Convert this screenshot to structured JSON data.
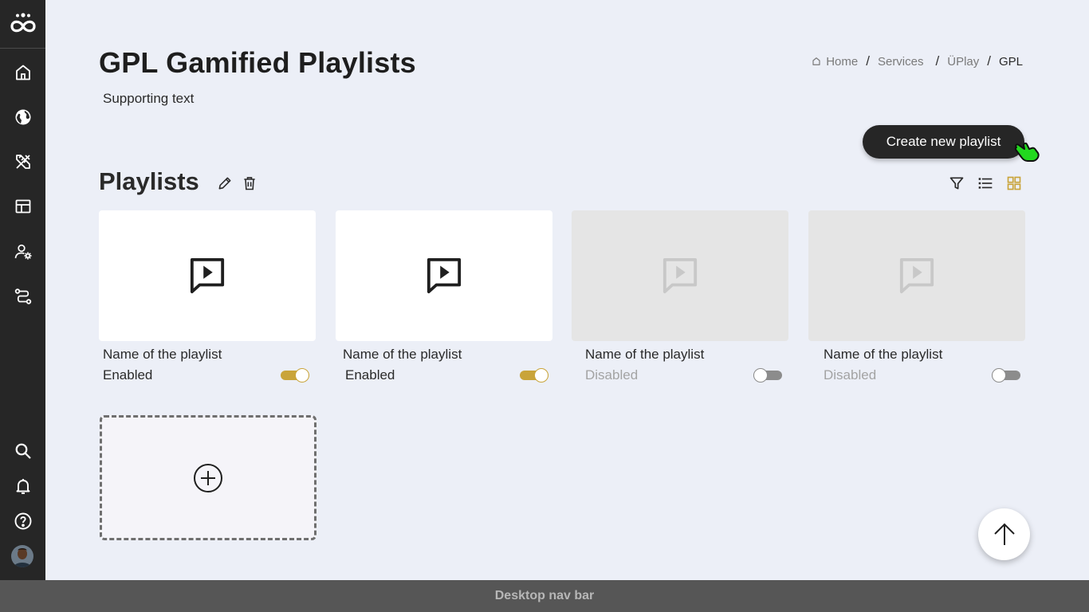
{
  "header": {
    "title": "GPL Gamified Playlists",
    "supporting_text": "Supporting text",
    "breadcrumb": [
      "Home",
      "Services",
      "ÜPlay",
      "GPL"
    ]
  },
  "actions": {
    "create_label": "Create new playlist"
  },
  "section": {
    "title": "Playlists"
  },
  "sidebar": {
    "items": [
      "home-icon",
      "globe-icon",
      "tools-icon",
      "dashboard-icon",
      "user-settings-icon",
      "route-icon"
    ],
    "bottom_items": [
      "search-icon",
      "bell-icon",
      "help-icon",
      "avatar"
    ]
  },
  "playlists": [
    {
      "name": "Name of the playlist",
      "status": "Enabled",
      "enabled": true
    },
    {
      "name": "Name of the playlist",
      "status": "Enabled",
      "enabled": true
    },
    {
      "name": "Name of the playlist",
      "status": "Disabled",
      "enabled": false
    },
    {
      "name": "Name of the playlist",
      "status": "Disabled",
      "enabled": false
    }
  ],
  "view": {
    "active": "grid",
    "accent": "#c9a43a"
  },
  "colors": {
    "sidebar": "#262626",
    "background": "#eceff7",
    "accent": "#c9a43a"
  },
  "footer": {
    "label": "Desktop nav bar"
  }
}
